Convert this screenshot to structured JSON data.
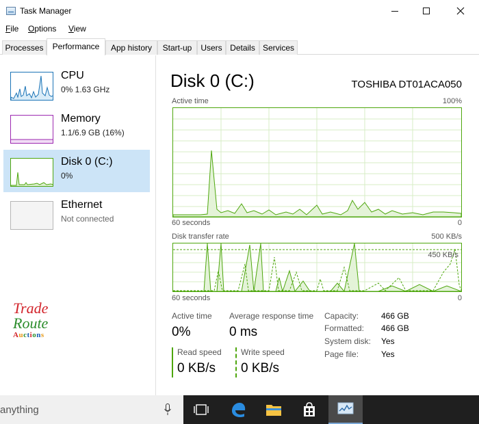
{
  "window": {
    "title": "Task Manager"
  },
  "menu": {
    "file": "File",
    "options": "Options",
    "view": "View"
  },
  "tabs": [
    {
      "label": "Processes"
    },
    {
      "label": "Performance"
    },
    {
      "label": "App history"
    },
    {
      "label": "Start-up"
    },
    {
      "label": "Users"
    },
    {
      "label": "Details"
    },
    {
      "label": "Services"
    }
  ],
  "sidebar": {
    "items": [
      {
        "label": "CPU",
        "sub": "0% 1.63 GHz",
        "color": "#1a73b6"
      },
      {
        "label": "Memory",
        "sub": "1.1/6.9 GB (16%)",
        "color": "#9c27b0"
      },
      {
        "label": "Disk 0 (C:)",
        "sub": "0%",
        "color": "#4da60c"
      },
      {
        "label": "Ethernet",
        "sub": "Not connected",
        "color": "#a0a0a0"
      }
    ]
  },
  "logo": {
    "line1": "Trade",
    "line2": "Route",
    "line3": "Auctions"
  },
  "main": {
    "title": "Disk 0 (C:)",
    "model": "TOSHIBA DT01ACA050",
    "active_graph": {
      "label": "Active time",
      "max": "100%",
      "left_footer": "60 seconds",
      "right_footer": "0"
    },
    "transfer_graph": {
      "label": "Disk transfer rate",
      "max": "500 KB/s",
      "marker": "450 KB/s",
      "left_footer": "60 seconds",
      "right_footer": "0"
    },
    "stats": {
      "active_time_label": "Active time",
      "active_time_value": "0%",
      "avg_response_label": "Average response time",
      "avg_response_value": "0 ms",
      "read_label": "Read speed",
      "read_value": "0 KB/s",
      "write_label": "Write speed",
      "write_value": "0 KB/s"
    },
    "info": [
      {
        "key": "Capacity:",
        "value": "466 GB"
      },
      {
        "key": "Formatted:",
        "value": "466 GB"
      },
      {
        "key": "System disk:",
        "value": "Yes"
      },
      {
        "key": "Page file:",
        "value": "Yes"
      }
    ],
    "accent": "#4da60c"
  },
  "taskbar": {
    "search_text": "anything"
  }
}
